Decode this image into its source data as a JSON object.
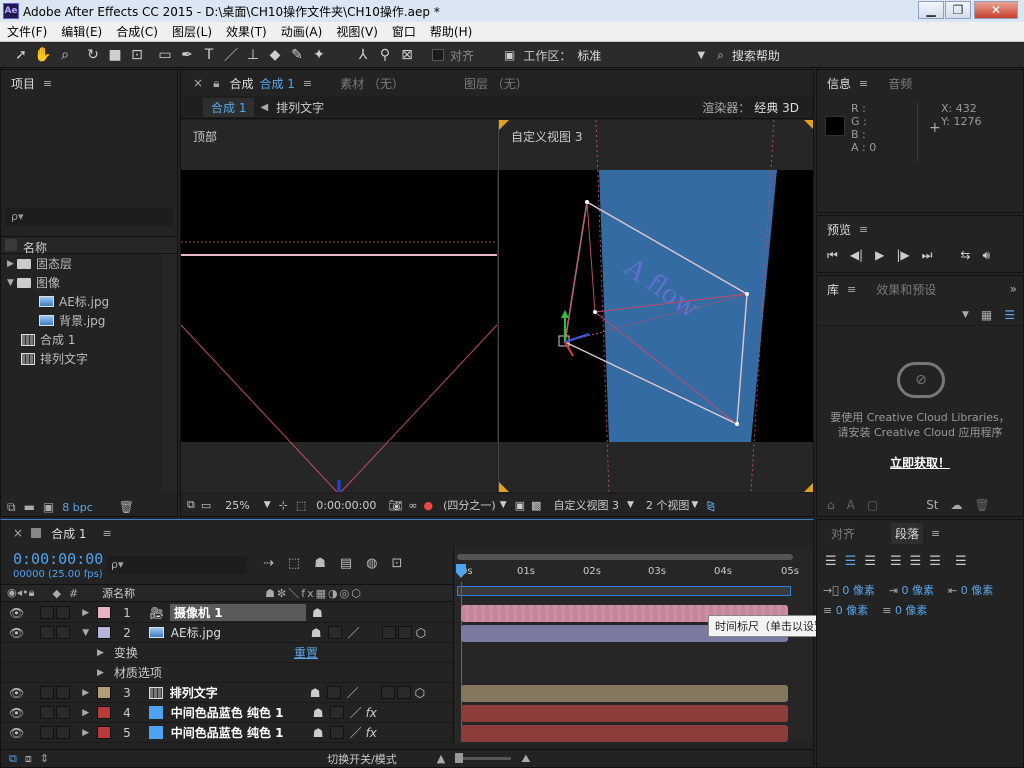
{
  "window": {
    "title": "Adobe After Effects CC 2015 - D:\\桌面\\CH10操作文件夹\\CH10操作.aep *",
    "app_icon": "Ae"
  },
  "menu": [
    "文件(F)",
    "编辑(E)",
    "合成(C)",
    "图层(L)",
    "效果(T)",
    "动画(A)",
    "视图(V)",
    "窗口",
    "帮助(H)"
  ],
  "toolbar": {
    "snap_label": "对齐",
    "workspace_label": "工作区：",
    "workspace_value": "标准",
    "search_help": "搜索帮助"
  },
  "project": {
    "title": "项目",
    "search_placeholder": "ρ▾",
    "col_name": "名称",
    "items": [
      {
        "label": "固态层",
        "type": "folder",
        "expanded": false
      },
      {
        "label": "图像",
        "type": "folder",
        "expanded": true
      },
      {
        "label": "AE标.jpg",
        "type": "image"
      },
      {
        "label": "背景.jpg",
        "type": "image"
      },
      {
        "label": "合成 1",
        "type": "comp"
      },
      {
        "label": "排列文字",
        "type": "comp"
      }
    ],
    "bpc": "8 bpc"
  },
  "composition": {
    "tab_prefix": "合成",
    "tab_name": "合成 1",
    "tab_footage": "素材 （无）",
    "tab_layer": "图层 （无）",
    "breadcrumb_active": "合成 1",
    "breadcrumb_next": "排列文字",
    "renderer_label": "渲染器：",
    "renderer_value": "经典 3D",
    "view_left": "顶部",
    "view_right": "自定义视图 3",
    "zoom": "25%",
    "timecode": "0:00:00:00",
    "resolution": "(四分之一)",
    "view_select": "自定义视图 3",
    "view_layout": "2 个视图"
  },
  "info": {
    "tab_info": "信息",
    "tab_audio": "音频",
    "r": "R :",
    "g": "G :",
    "b": "B :",
    "a": "A : 0",
    "x": "X: 432",
    "y": "Y: 1276"
  },
  "preview": {
    "title": "预览"
  },
  "library": {
    "tab_lib": "库",
    "tab_effects": "效果和预设",
    "message_line1": "要使用 Creative Cloud Libraries，",
    "message_line2": "请安装 Creative Cloud 应用程序",
    "get_now": "立即获取！"
  },
  "paragraph": {
    "tab_align": "对齐",
    "tab_para": "段落",
    "indent_left": "0 像素",
    "indent_right": "0 像素",
    "first_line": "0 像素",
    "space_before": "0 像素",
    "space_after": "0 像素"
  },
  "timeline": {
    "tab": "合成 1",
    "timecode": "0:00:00:00",
    "fps": "00000 (25.00 fps)",
    "search_placeholder": "ρ▾",
    "col_source": "源名称",
    "col_num": "#",
    "reset": "重置",
    "toggle_modes": "切换开关/模式",
    "ruler": [
      "0s",
      "01s",
      "02s",
      "03s",
      "04s",
      "05s"
    ],
    "tooltip": "时间标尺（单击以设置缩览图）",
    "layers": [
      {
        "num": "1",
        "name": "摄像机 1",
        "color": "#e8b4c4",
        "bar": "#c4849a",
        "type": "camera"
      },
      {
        "num": "2",
        "name": "AE标.jpg",
        "color": "#b6b5d8",
        "bar": "#7a7aa0",
        "type": "image"
      },
      {
        "num": "",
        "name": "变换",
        "sub": true
      },
      {
        "num": "",
        "name": "材质选项",
        "sub": true
      },
      {
        "num": "3",
        "name": "排列文字",
        "color": "#b49e78",
        "bar": "#85775f",
        "type": "comp"
      },
      {
        "num": "4",
        "name": "中间色品蓝色 纯色 1",
        "color": "#b83a3a",
        "bar": "#8e3b3b",
        "type": "solid"
      },
      {
        "num": "5",
        "name": "中间色品蓝色 纯色 1",
        "color": "#b83a3a",
        "bar": "#8e3b3b",
        "type": "solid"
      }
    ]
  }
}
